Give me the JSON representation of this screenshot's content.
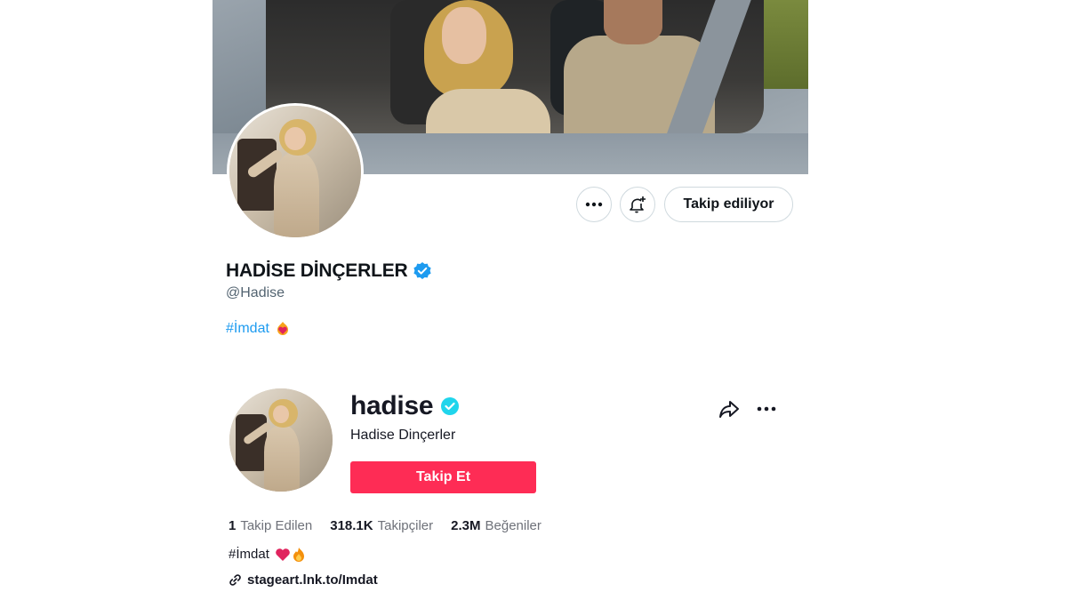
{
  "top_profile": {
    "display_name": "HADİSE DİNÇERLER",
    "handle": "@Hadise",
    "bio_tag": "#İmdat",
    "following_button": "Takip ediliyor",
    "more_icon": "more-horizontal-icon",
    "bell_icon": "bell-plus-icon",
    "verified_icon": "verified-badge-icon",
    "verified_color": "#1d9bf0"
  },
  "tiktok_profile": {
    "username": "hadise",
    "display_name": "Hadise Dinçerler",
    "follow_button": "Takip Et",
    "follow_color": "#fe2c55",
    "verified_color": "#20d5ec",
    "stats": [
      {
        "value": "1",
        "label": "Takip Edilen"
      },
      {
        "value": "318.1K",
        "label": "Takipçiler"
      },
      {
        "value": "2.3M",
        "label": "Beğeniler"
      }
    ],
    "bio": "#İmdat",
    "link": "stageart.lnk.to/Imdat",
    "share_icon": "share-icon",
    "more_icon": "more-horizontal-icon",
    "link_icon": "link-icon"
  }
}
